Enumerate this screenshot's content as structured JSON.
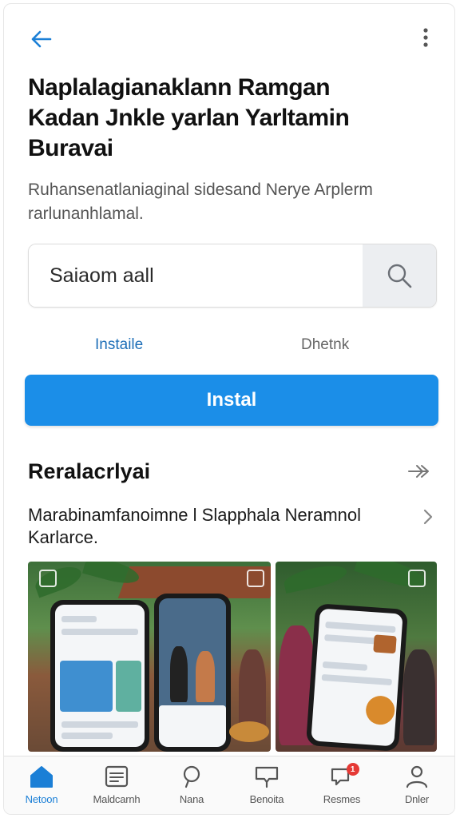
{
  "header": {
    "title_lines": [
      "Naplalagianaklann Ramgan",
      "Kadan Jnkle yarlan Yarltamin",
      "Buravai"
    ],
    "subtitle_lines": [
      "Ruhansenatlaniaginal sidesand Nerye Arplerm",
      "rarlunanhlamal."
    ]
  },
  "search": {
    "placeholder": "Saiaom aall"
  },
  "links": {
    "primary": "Instaile",
    "secondary": "Dhetnk"
  },
  "install_button": {
    "label": "Instal"
  },
  "section": {
    "title": "Reralacrlyai",
    "row_lines": [
      "Marabinamfanoimne l Slapphala Neramnol",
      "Karlarce."
    ]
  },
  "gallery": {
    "photos": [
      "photo-1",
      "photo-2"
    ]
  },
  "bottom_nav": {
    "items": [
      {
        "label": "Netoon",
        "icon": "home-icon",
        "active": true
      },
      {
        "label": "Maldcarnh",
        "icon": "news-icon",
        "active": false
      },
      {
        "label": "Nana",
        "icon": "search-icon",
        "active": false
      },
      {
        "label": "Benoita",
        "icon": "chat-icon",
        "active": false
      },
      {
        "label": "Resmes",
        "icon": "bell-icon",
        "active": false,
        "badge": "1"
      },
      {
        "label": "Dnler",
        "icon": "profile-icon",
        "active": false
      }
    ]
  },
  "colors": {
    "accent": "#1b8ee8",
    "link": "#1e6fb8",
    "badge": "#e53935"
  }
}
